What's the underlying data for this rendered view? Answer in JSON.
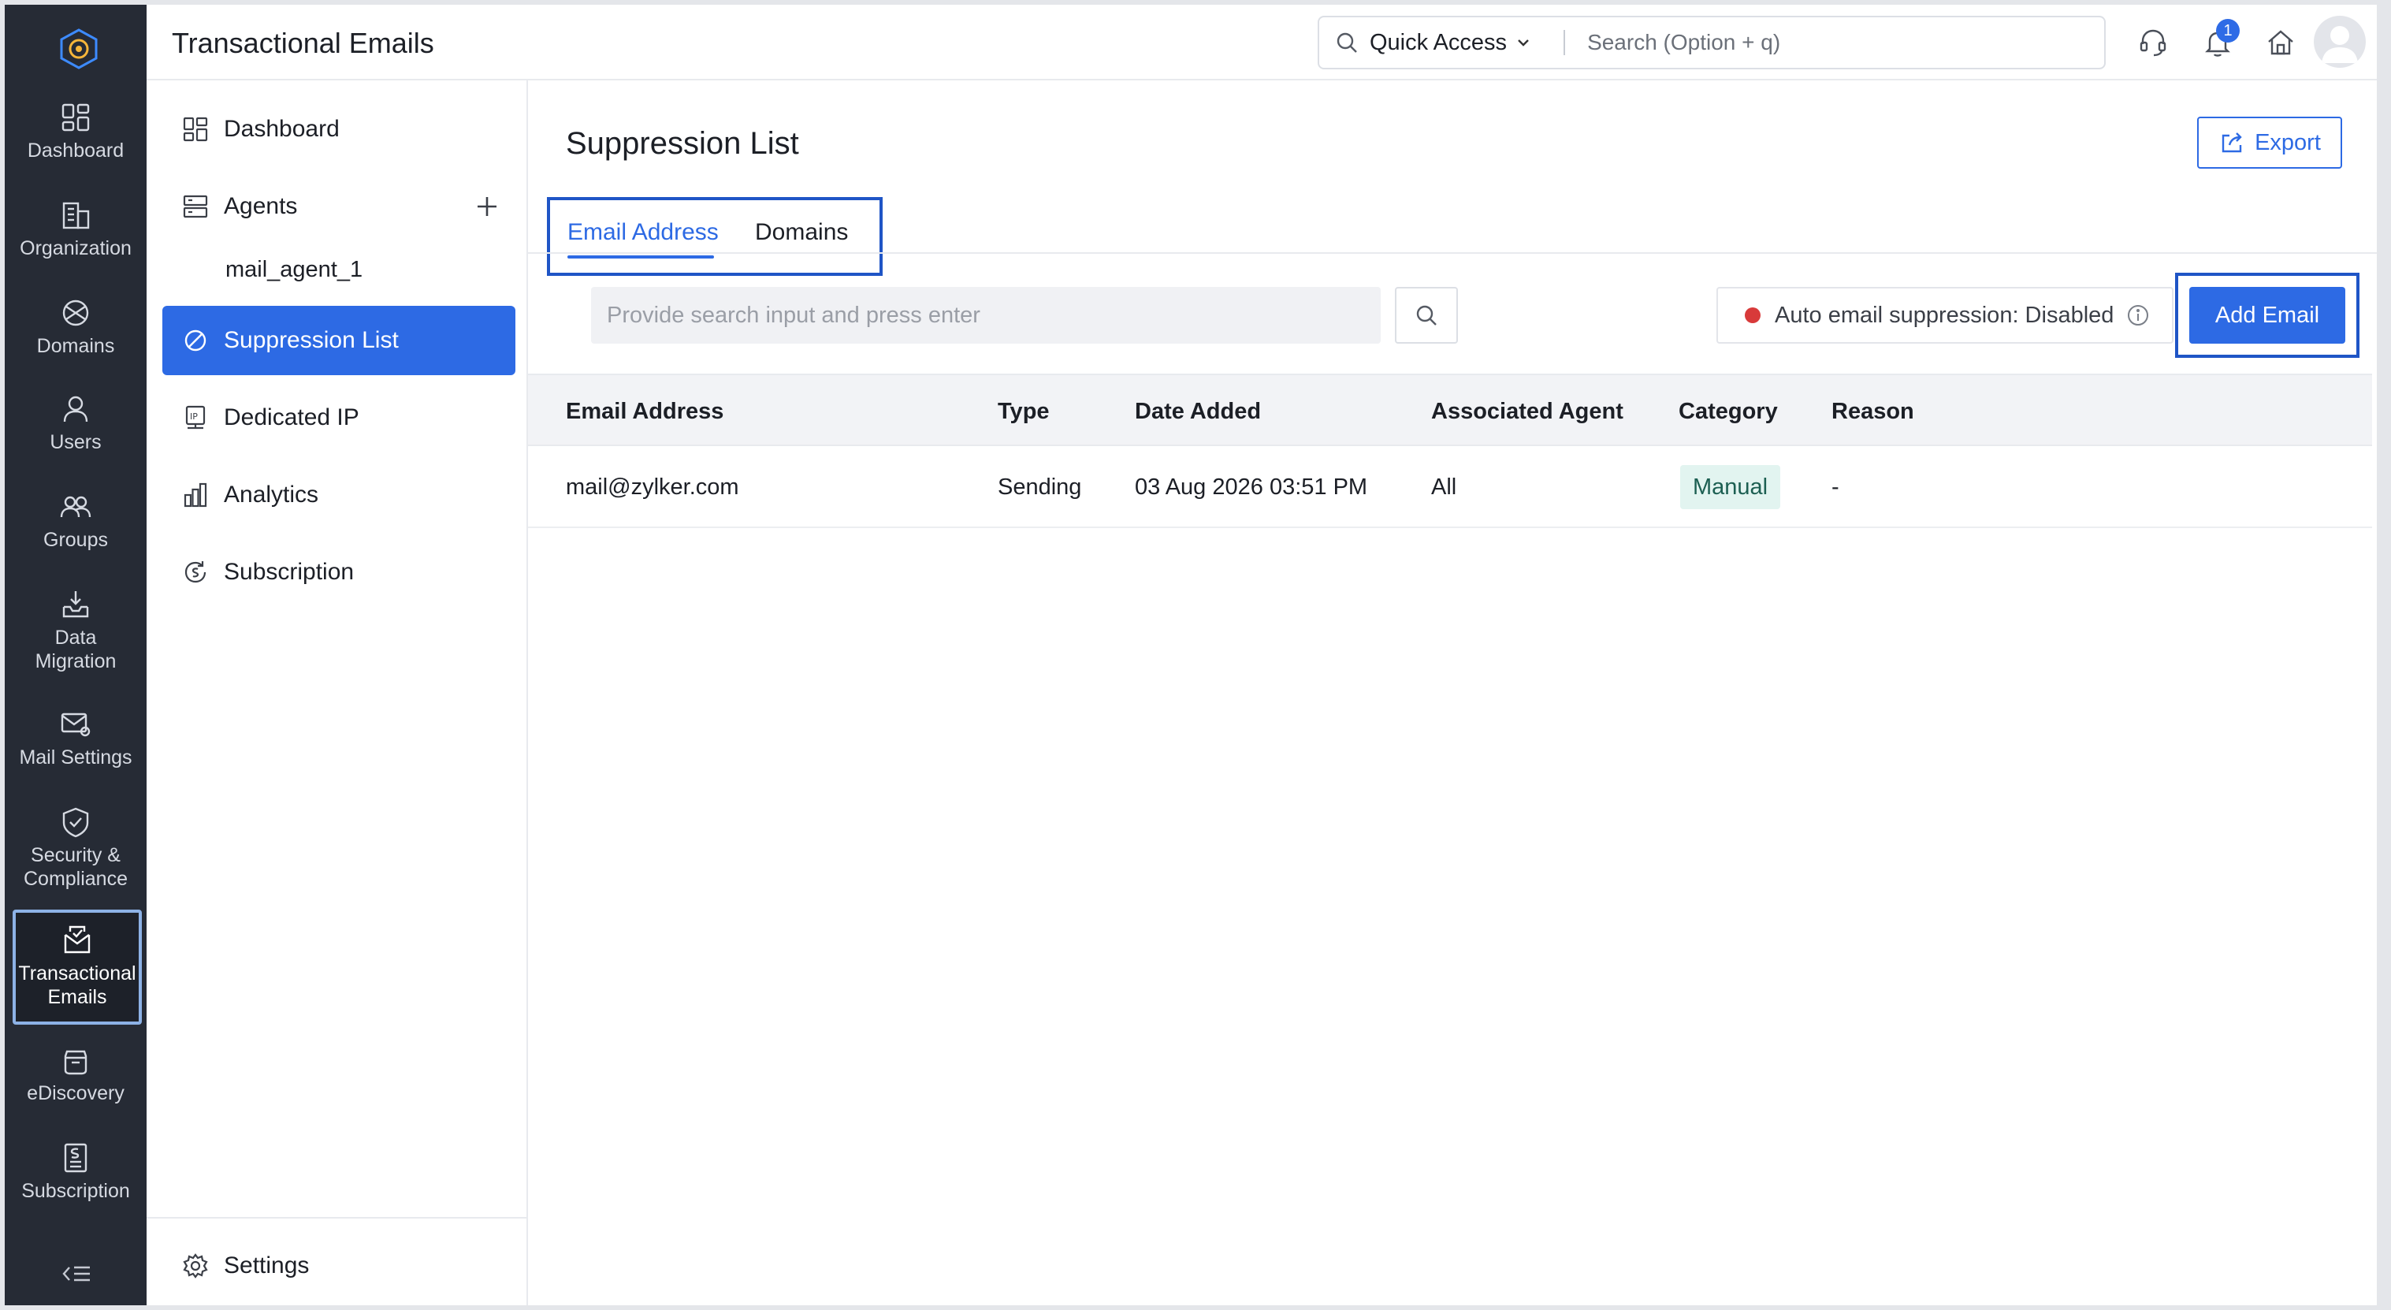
{
  "header": {
    "app_title": "Transactional Emails",
    "quick_access_label": "Quick Access",
    "search_placeholder": "Search (Option + q)",
    "notification_count": "1"
  },
  "rail": {
    "items": [
      {
        "label": "Dashboard",
        "icon": "dashboard-icon"
      },
      {
        "label": "Organization",
        "icon": "building-icon"
      },
      {
        "label": "Domains",
        "icon": "globe-icon"
      },
      {
        "label": "Users",
        "icon": "user-icon"
      },
      {
        "label": "Groups",
        "icon": "group-icon"
      },
      {
        "label": "Data\nMigration",
        "icon": "inbox-download-icon"
      },
      {
        "label": "Mail Settings",
        "icon": "mail-gear-icon"
      },
      {
        "label": "Security &\nCompliance",
        "icon": "shield-check-icon"
      },
      {
        "label": "Transactional\nEmails",
        "icon": "transactional-mail-icon"
      },
      {
        "label": "eDiscovery",
        "icon": "archive-jar-icon"
      },
      {
        "label": "Subscription",
        "icon": "invoice-icon"
      }
    ],
    "active_item": "Transactional\nEmails"
  },
  "subnav": {
    "dashboard": "Dashboard",
    "agents": "Agents",
    "agent_1": "mail_agent_1",
    "suppression_list": "Suppression List",
    "dedicated_ip": "Dedicated IP",
    "analytics": "Analytics",
    "subscription": "Subscription",
    "settings": "Settings"
  },
  "main": {
    "page_title": "Suppression List",
    "export_label": "Export",
    "tabs": [
      {
        "label": "Email Address",
        "active": true
      },
      {
        "label": "Domains",
        "active": false
      }
    ],
    "search_placeholder": "Provide search input and press enter",
    "auto_suppression": "Auto email suppression: Disabled",
    "add_email_label": "Add Email"
  },
  "table": {
    "columns": [
      "Email Address",
      "Type",
      "Date Added",
      "Associated Agent",
      "Category",
      "Reason"
    ],
    "rows": [
      {
        "email": "mail@zylker.com",
        "type": "Sending",
        "date_added": "03 Aug 2026 03:51 PM",
        "agent": "All",
        "category": "Manual",
        "reason": "-"
      }
    ]
  },
  "colors": {
    "accent": "#2d6ae4",
    "rail_bg": "#262b35",
    "status_disabled": "#d83a3a",
    "category_badge_bg": "#e2f4f0"
  }
}
